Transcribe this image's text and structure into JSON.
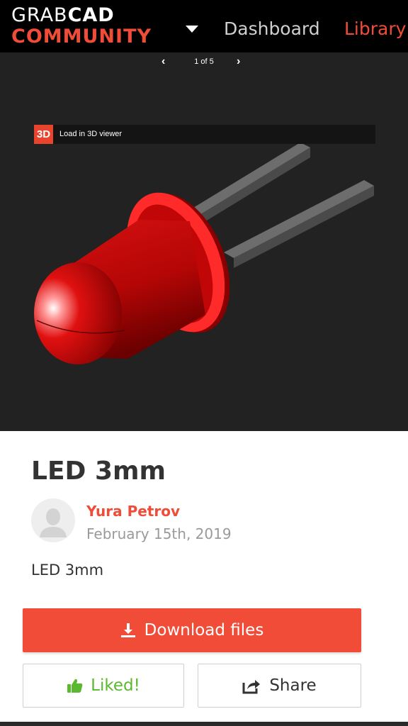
{
  "header": {
    "logo_top": "GRAB",
    "logo_top_bold": "CAD",
    "logo_bottom": "COMMUNITY",
    "nav": {
      "dashboard": "Dashboard",
      "library": "Library"
    }
  },
  "viewer": {
    "pager": {
      "current": 1,
      "total": 5,
      "label": "1 of 5"
    },
    "badge": "3D",
    "load_label": "Load in 3D viewer"
  },
  "model": {
    "title": "LED 3mm",
    "author": "Yura Petrov",
    "date": "February 15th, 2019",
    "description": "LED 3mm"
  },
  "actions": {
    "download_label": "Download files",
    "like_label": "Liked!",
    "share_label": "Share"
  },
  "colors": {
    "brand": "#f04c38",
    "liked": "#5cb82f",
    "header_bg": "#000000",
    "viewer_bg": "#222222"
  },
  "icons": {
    "download": "download-icon",
    "like": "thumbs-up-icon",
    "share": "share-icon",
    "caret": "chevron-down-icon",
    "prev": "chevron-left-icon",
    "next": "chevron-right-icon"
  }
}
